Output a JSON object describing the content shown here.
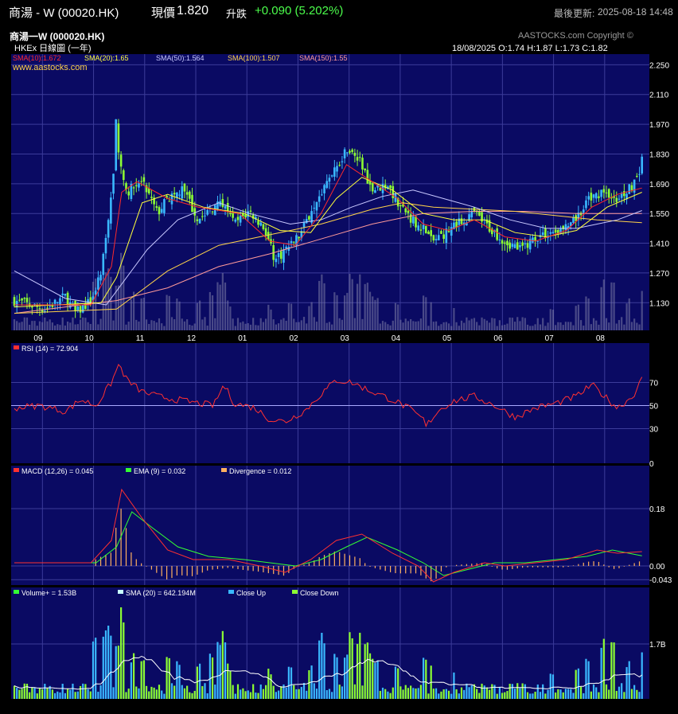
{
  "header": {
    "stock_name": "商湯 - W (00020.HK)",
    "price_label": "現價",
    "price": "1.820",
    "change_label": "升跌",
    "change": "+0.090 (5.202%)",
    "update_label": "最後更新:",
    "update_time": "2025-08-18 14:48"
  },
  "chart_header": {
    "title": "商湯一W (000020.HK)",
    "copyright": "AASTOCKS.com Copyright ©",
    "subtitle": "HKEx 日線圖 (一年)",
    "ohlc": "18/08/2025  O:1.74  H:1.87  L:1.73  C:1.82",
    "website": "www.aastocks.com"
  },
  "colors": {
    "panel_bg": "#0a0a63",
    "grid": "#3c3c9a",
    "candle_up": "#3ab8ff",
    "candle_down": "#8cff33",
    "sma10": "#ff2a2a",
    "sma20": "#ffff3a",
    "sma50": "#c8c8ff",
    "sma100": "#ffd24a",
    "sma150": "#ff9a9a",
    "rsi": "#ff3030",
    "macd": "#ff3030",
    "ema": "#33ff33",
    "divergence": "#ffb060",
    "vol_sma": "#ffffff"
  },
  "chart_data": [
    {
      "type": "candlestick",
      "title": "商湯一W (000020.HK)",
      "x_ticks": [
        "09",
        "10",
        "11",
        "12",
        "01",
        "02",
        "03",
        "04",
        "05",
        "06",
        "07",
        "08"
      ],
      "y_ticks": [
        2.25,
        2.11,
        1.97,
        1.83,
        1.69,
        1.55,
        1.41,
        1.27,
        1.13
      ],
      "ylim": [
        1.0,
        2.3
      ],
      "legend": [
        {
          "name": "SMA(10)",
          "value": "1.672"
        },
        {
          "name": "SMA(20)",
          "value": "1.65"
        },
        {
          "name": "SMA(50)",
          "value": "1.564"
        },
        {
          "name": "SMA(100)",
          "value": "1.507"
        },
        {
          "name": "SMA(150)",
          "value": "1.55"
        }
      ],
      "last_ohlc": {
        "date": "18/08/2025",
        "open": 1.74,
        "high": 1.87,
        "low": 1.73,
        "close": 1.82
      },
      "close_path": [
        [
          0.0,
          1.14
        ],
        [
          0.6,
          1.1
        ],
        [
          1.0,
          1.16
        ],
        [
          1.2,
          1.08
        ],
        [
          1.5,
          1.14
        ],
        [
          1.7,
          1.26
        ],
        [
          1.85,
          1.55
        ],
        [
          1.95,
          1.75
        ],
        [
          2.0,
          2.05
        ],
        [
          2.05,
          1.8
        ],
        [
          2.2,
          1.65
        ],
        [
          2.5,
          1.7
        ],
        [
          2.8,
          1.55
        ],
        [
          3.0,
          1.62
        ],
        [
          3.3,
          1.66
        ],
        [
          3.6,
          1.52
        ],
        [
          3.9,
          1.58
        ],
        [
          4.1,
          1.6
        ],
        [
          4.3,
          1.5
        ],
        [
          4.6,
          1.56
        ],
        [
          4.9,
          1.48
        ],
        [
          5.1,
          1.33
        ],
        [
          5.3,
          1.38
        ],
        [
          5.6,
          1.45
        ],
        [
          5.9,
          1.62
        ],
        [
          6.2,
          1.72
        ],
        [
          6.5,
          1.86
        ],
        [
          6.8,
          1.78
        ],
        [
          7.0,
          1.66
        ],
        [
          7.3,
          1.69
        ],
        [
          7.5,
          1.6
        ],
        [
          7.8,
          1.52
        ],
        [
          8.0,
          1.48
        ],
        [
          8.2,
          1.42
        ],
        [
          8.5,
          1.47
        ],
        [
          8.8,
          1.52
        ],
        [
          9.0,
          1.55
        ],
        [
          9.3,
          1.48
        ],
        [
          9.6,
          1.42
        ],
        [
          9.9,
          1.38
        ],
        [
          10.2,
          1.44
        ],
        [
          10.5,
          1.46
        ],
        [
          10.8,
          1.48
        ],
        [
          11.0,
          1.52
        ],
        [
          11.2,
          1.6
        ],
        [
          11.5,
          1.66
        ],
        [
          11.8,
          1.62
        ],
        [
          12.0,
          1.66
        ],
        [
          12.2,
          1.72
        ],
        [
          12.28,
          1.82
        ]
      ],
      "sma10_path": [
        [
          0.0,
          1.12
        ],
        [
          1.5,
          1.12
        ],
        [
          1.9,
          1.3
        ],
        [
          2.1,
          1.65
        ],
        [
          2.4,
          1.7
        ],
        [
          3.0,
          1.62
        ],
        [
          3.6,
          1.58
        ],
        [
          4.4,
          1.55
        ],
        [
          5.0,
          1.42
        ],
        [
          5.5,
          1.4
        ],
        [
          6.0,
          1.55
        ],
        [
          6.5,
          1.78
        ],
        [
          7.0,
          1.7
        ],
        [
          7.5,
          1.62
        ],
        [
          8.0,
          1.5
        ],
        [
          8.5,
          1.47
        ],
        [
          9.0,
          1.52
        ],
        [
          9.6,
          1.44
        ],
        [
          10.2,
          1.42
        ],
        [
          10.8,
          1.47
        ],
        [
          11.3,
          1.58
        ],
        [
          11.8,
          1.64
        ],
        [
          12.28,
          1.67
        ]
      ],
      "sma20_path": [
        [
          0.0,
          1.11
        ],
        [
          1.7,
          1.13
        ],
        [
          2.0,
          1.25
        ],
        [
          2.5,
          1.6
        ],
        [
          3.0,
          1.64
        ],
        [
          3.7,
          1.58
        ],
        [
          4.5,
          1.55
        ],
        [
          5.2,
          1.47
        ],
        [
          5.8,
          1.46
        ],
        [
          6.3,
          1.62
        ],
        [
          6.8,
          1.72
        ],
        [
          7.4,
          1.66
        ],
        [
          8.0,
          1.55
        ],
        [
          8.6,
          1.52
        ],
        [
          9.2,
          1.52
        ],
        [
          9.8,
          1.46
        ],
        [
          10.4,
          1.44
        ],
        [
          11.0,
          1.47
        ],
        [
          11.6,
          1.58
        ],
        [
          12.28,
          1.65
        ]
      ],
      "sma50_path": [
        [
          0.0,
          1.28
        ],
        [
          1.0,
          1.15
        ],
        [
          1.8,
          1.12
        ],
        [
          2.6,
          1.38
        ],
        [
          3.2,
          1.52
        ],
        [
          4.0,
          1.6
        ],
        [
          4.6,
          1.55
        ],
        [
          5.4,
          1.5
        ],
        [
          6.0,
          1.52
        ],
        [
          6.6,
          1.58
        ],
        [
          7.2,
          1.63
        ],
        [
          7.8,
          1.66
        ],
        [
          8.4,
          1.62
        ],
        [
          9.0,
          1.58
        ],
        [
          9.7,
          1.52
        ],
        [
          10.4,
          1.48
        ],
        [
          11.0,
          1.48
        ],
        [
          11.8,
          1.52
        ],
        [
          12.28,
          1.564
        ]
      ],
      "sma100_path": [
        [
          0.0,
          1.08
        ],
        [
          2.0,
          1.1
        ],
        [
          3.0,
          1.28
        ],
        [
          4.0,
          1.4
        ],
        [
          5.0,
          1.45
        ],
        [
          6.0,
          1.5
        ],
        [
          7.0,
          1.57
        ],
        [
          7.6,
          1.6
        ],
        [
          8.2,
          1.58
        ],
        [
          9.0,
          1.57
        ],
        [
          9.8,
          1.56
        ],
        [
          10.6,
          1.54
        ],
        [
          11.4,
          1.52
        ],
        [
          12.28,
          1.507
        ]
      ],
      "sma150_path": [
        [
          0.0,
          1.08
        ],
        [
          2.0,
          1.14
        ],
        [
          3.0,
          1.2
        ],
        [
          4.0,
          1.3
        ],
        [
          5.0,
          1.36
        ],
        [
          6.0,
          1.43
        ],
        [
          7.0,
          1.5
        ],
        [
          8.0,
          1.55
        ],
        [
          9.0,
          1.56
        ],
        [
          10.0,
          1.56
        ],
        [
          11.0,
          1.55
        ],
        [
          12.28,
          1.55
        ]
      ]
    },
    {
      "type": "line",
      "title": "RSI (14) = 72.904",
      "y_ticks": [
        70,
        50,
        30,
        0
      ],
      "ylim": [
        0,
        100
      ],
      "series": [
        {
          "name": "RSI (14)",
          "value": "72.904",
          "path": [
            [
              0.0,
              48
            ],
            [
              0.5,
              50
            ],
            [
              1.0,
              45
            ],
            [
              1.3,
              55
            ],
            [
              1.6,
              50
            ],
            [
              1.9,
              70
            ],
            [
              2.05,
              86
            ],
            [
              2.2,
              72
            ],
            [
              2.5,
              62
            ],
            [
              2.8,
              58
            ],
            [
              3.2,
              55
            ],
            [
              3.6,
              52
            ],
            [
              3.9,
              50
            ],
            [
              4.1,
              68
            ],
            [
              4.3,
              52
            ],
            [
              4.7,
              48
            ],
            [
              5.0,
              38
            ],
            [
              5.3,
              36
            ],
            [
              5.7,
              46
            ],
            [
              6.0,
              60
            ],
            [
              6.3,
              72
            ],
            [
              6.6,
              70
            ],
            [
              7.0,
              62
            ],
            [
              7.4,
              55
            ],
            [
              7.7,
              48
            ],
            [
              8.0,
              38
            ],
            [
              8.05,
              32
            ],
            [
              8.3,
              46
            ],
            [
              8.6,
              54
            ],
            [
              9.0,
              58
            ],
            [
              9.4,
              50
            ],
            [
              9.8,
              40
            ],
            [
              10.2,
              48
            ],
            [
              10.6,
              52
            ],
            [
              11.0,
              58
            ],
            [
              11.3,
              68
            ],
            [
              11.5,
              60
            ],
            [
              11.8,
              48
            ],
            [
              12.1,
              58
            ],
            [
              12.28,
              72.904
            ]
          ]
        }
      ]
    },
    {
      "type": "line",
      "title": "MACD (12,26)",
      "y_ticks": [
        0.18,
        0.0,
        -0.043
      ],
      "ylim": [
        -0.06,
        0.3
      ],
      "series": [
        {
          "name": "MACD (12,26)",
          "value": "0.045",
          "path": [
            [
              0.0,
              0.01
            ],
            [
              1.5,
              0.01
            ],
            [
              1.9,
              0.08
            ],
            [
              2.1,
              0.24
            ],
            [
              2.5,
              0.15
            ],
            [
              3.0,
              0.05
            ],
            [
              3.5,
              0.02
            ],
            [
              4.2,
              0.02
            ],
            [
              4.8,
              0.0
            ],
            [
              5.3,
              -0.02
            ],
            [
              5.8,
              0.02
            ],
            [
              6.3,
              0.08
            ],
            [
              6.8,
              0.1
            ],
            [
              7.4,
              0.04
            ],
            [
              7.9,
              0.0
            ],
            [
              8.2,
              -0.05
            ],
            [
              8.6,
              -0.02
            ],
            [
              9.2,
              0.01
            ],
            [
              9.6,
              0.0
            ],
            [
              10.2,
              0.01
            ],
            [
              10.8,
              0.02
            ],
            [
              11.4,
              0.05
            ],
            [
              11.8,
              0.04
            ],
            [
              12.28,
              0.045
            ]
          ]
        },
        {
          "name": "EMA (9)",
          "value": "0.032",
          "path": [
            [
              0.0,
              0.01
            ],
            [
              1.6,
              0.01
            ],
            [
              2.0,
              0.06
            ],
            [
              2.3,
              0.17
            ],
            [
              2.7,
              0.12
            ],
            [
              3.2,
              0.06
            ],
            [
              3.8,
              0.03
            ],
            [
              4.5,
              0.02
            ],
            [
              5.0,
              0.01
            ],
            [
              5.5,
              0.0
            ],
            [
              6.0,
              0.02
            ],
            [
              6.5,
              0.06
            ],
            [
              6.9,
              0.09
            ],
            [
              7.5,
              0.05
            ],
            [
              8.0,
              0.01
            ],
            [
              8.4,
              -0.03
            ],
            [
              8.9,
              -0.01
            ],
            [
              9.4,
              0.01
            ],
            [
              10.0,
              0.01
            ],
            [
              10.6,
              0.02
            ],
            [
              11.2,
              0.03
            ],
            [
              11.7,
              0.05
            ],
            [
              12.28,
              0.032
            ]
          ]
        }
      ],
      "divergence": {
        "name": "Divergence",
        "value": "0.012"
      }
    },
    {
      "type": "bar",
      "title": "Volume+",
      "y_ticks": [
        "1.7B"
      ],
      "legend": [
        {
          "name": "Volume+",
          "value": "1.53B"
        },
        {
          "name": "SMA (20)",
          "value": "642.194M"
        },
        {
          "name": "Close Up",
          "value": ""
        },
        {
          "name": "Close Down",
          "value": ""
        }
      ],
      "heavy_days": [
        [
          1.55,
          1.9
        ],
        [
          1.75,
          2.1
        ],
        [
          1.82,
          2.8
        ],
        [
          1.88,
          2.0
        ],
        [
          2.0,
          2.1
        ],
        [
          2.05,
          2.0
        ],
        [
          2.1,
          3.0
        ],
        [
          2.12,
          2.2
        ],
        [
          2.3,
          1.5
        ],
        [
          2.5,
          1.2
        ],
        [
          3.0,
          1.4
        ],
        [
          3.2,
          1.3
        ],
        [
          3.6,
          1.2
        ],
        [
          3.85,
          1.6
        ],
        [
          4.0,
          1.8
        ],
        [
          4.05,
          2.2
        ],
        [
          4.1,
          1.9
        ],
        [
          4.2,
          1.1
        ],
        [
          5.0,
          1.0
        ],
        [
          5.4,
          1.2
        ],
        [
          5.8,
          1.1
        ],
        [
          6.0,
          2.4
        ],
        [
          6.05,
          1.9
        ],
        [
          6.3,
          1.6
        ],
        [
          6.5,
          1.7
        ],
        [
          6.6,
          2.2
        ],
        [
          6.75,
          2.1
        ],
        [
          6.9,
          1.9
        ],
        [
          7.0,
          1.5
        ],
        [
          7.1,
          1.3
        ],
        [
          7.5,
          1.2
        ],
        [
          8.0,
          1.3
        ],
        [
          8.05,
          1.6
        ],
        [
          8.15,
          1.1
        ],
        [
          8.6,
          0.9
        ],
        [
          10.5,
          0.9
        ],
        [
          11.0,
          1.1
        ],
        [
          11.2,
          1.3
        ],
        [
          11.5,
          1.9
        ],
        [
          11.7,
          1.8
        ],
        [
          12.0,
          1.3
        ],
        [
          12.28,
          1.53
        ]
      ]
    }
  ]
}
